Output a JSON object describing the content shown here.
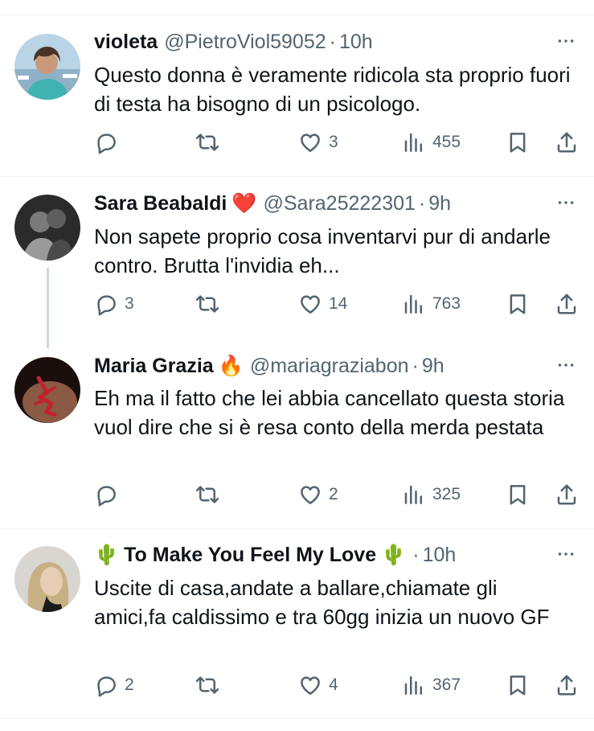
{
  "tweets": [
    {
      "name": "violeta",
      "handle": "@PietroViol59052",
      "sep": "·",
      "time": "10h",
      "text": "Questo donna è veramente ridicola sta proprio fuori di testa ha bisogno di un psicologo.",
      "replies": "",
      "retweets": "",
      "likes": "3",
      "views": "455"
    },
    {
      "name": "Sara Beabaldi",
      "name_emoji": "❤️",
      "handle": "@Sara25222301",
      "sep": "·",
      "time": "9h",
      "text": "Non sapete proprio cosa inventarvi pur di andarle contro. Brutta l'invidia eh...",
      "replies": "3",
      "retweets": "",
      "likes": "14",
      "views": "763"
    },
    {
      "name": "Maria Grazia",
      "name_emoji": "🔥",
      "handle": "@mariagraziabon",
      "sep": "·",
      "time": "9h",
      "text": "Eh ma il fatto che lei abbia cancellato questa storia vuol dire che si è resa conto della merda pestata",
      "replies": "",
      "retweets": "",
      "likes": "2",
      "views": "325"
    },
    {
      "name": "To Make You Feel My Love",
      "name_emoji_left": "🌵",
      "name_emoji_right": "🌵",
      "sep": "·",
      "time": "10h",
      "text": "Uscite di casa,andate a ballare,chiamate gli amici,fa caldissimo e tra 60gg inizia un nuovo GF",
      "replies": "2",
      "retweets": "",
      "likes": "4",
      "views": "367"
    }
  ],
  "colors": {
    "text": "#0f1419",
    "secondary": "#536471",
    "divider": "#eff3f4",
    "thread_line": "#cfd9de"
  },
  "icons": [
    "reply-icon",
    "retweet-icon",
    "like-icon",
    "views-icon",
    "bookmark-icon",
    "share-icon",
    "more-icon"
  ]
}
